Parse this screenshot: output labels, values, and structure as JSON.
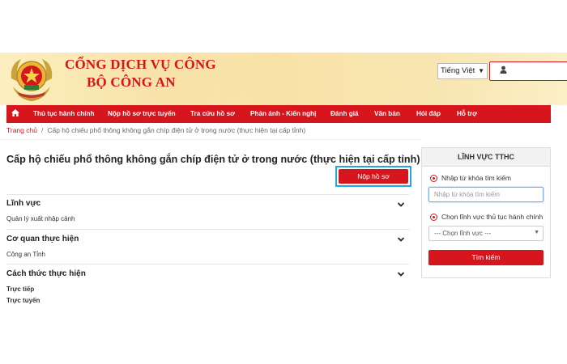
{
  "header": {
    "title_line1": "CỔNG DỊCH VỤ CÔNG",
    "title_line2": "BỘ CÔNG AN",
    "language": "Tiếng Việt",
    "user_icon": "user-icon"
  },
  "nav": {
    "home_icon": "home-icon",
    "items": [
      {
        "label": "Thủ tục hành chính"
      },
      {
        "label": "Nộp hồ sơ trực tuyến"
      },
      {
        "label": "Tra cứu hồ sơ"
      },
      {
        "label": "Phản ánh - Kiến nghị"
      },
      {
        "label": "Đánh giá"
      },
      {
        "label": "Văn bản"
      },
      {
        "label": "Hỏi đáp"
      },
      {
        "label": "Hỗ trợ"
      }
    ]
  },
  "breadcrumb": {
    "home": "Trang chủ",
    "separator": "/",
    "current": "Cấp hộ chiếu phổ thông không gắn chíp điện tử ở trong nước (thực hiện tại cấp tỉnh)"
  },
  "main": {
    "title": "Cấp hộ chiếu phổ thông không gắn chíp điện tử ở trong nước (thực hiện tại cấp tỉnh)",
    "submit_label": "Nộp hồ sơ",
    "sections": [
      {
        "heading": "Lĩnh vực",
        "values": [
          "Quản lý xuất nhập cảnh"
        ]
      },
      {
        "heading": "Cơ quan thực hiện",
        "values": [
          "Công an Tỉnh"
        ]
      },
      {
        "heading": "Cách thức thực hiện",
        "values": [
          "Trực tiếp",
          "Trực tuyến"
        ]
      }
    ]
  },
  "side": {
    "heading": "LĨNH VỰC TTHC",
    "keyword_label": "Nhập từ khóa tìm kiếm",
    "keyword_placeholder": "Nhập từ khóa tìm kiếm",
    "field_label": "Chọn lĩnh vực thủ tục hành chính",
    "field_selected": "--- Chọn lĩnh vực ---",
    "search_label": "Tìm kiếm"
  },
  "colors": {
    "brand_red": "#d6151c",
    "highlight_blue": "#2aa4dd"
  }
}
